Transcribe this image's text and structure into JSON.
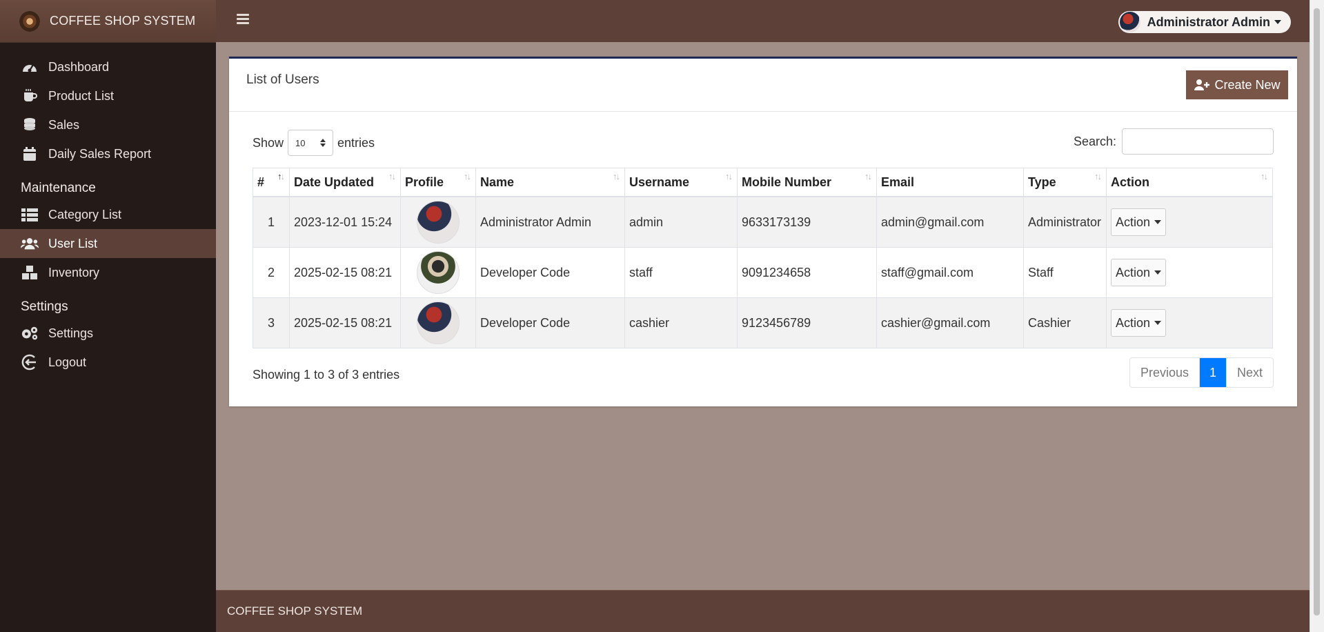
{
  "brand": {
    "title": "COFFEE SHOP SYSTEM"
  },
  "sidebar": {
    "items": [
      {
        "label": "Dashboard",
        "icon": "gauge-icon"
      },
      {
        "label": "Product List",
        "icon": "coffee-cup-icon"
      },
      {
        "label": "Sales",
        "icon": "coins-icon"
      },
      {
        "label": "Daily Sales Report",
        "icon": "calendar-icon"
      }
    ],
    "maintenance_header": "Maintenance",
    "maintenance_items": [
      {
        "label": "Category List",
        "icon": "table-list-icon"
      },
      {
        "label": "User List",
        "icon": "users-icon",
        "active": true
      },
      {
        "label": "Inventory",
        "icon": "boxes-icon"
      }
    ],
    "settings_header": "Settings",
    "settings_items": [
      {
        "label": "Settings",
        "icon": "gears-icon"
      },
      {
        "label": "Logout",
        "icon": "logout-icon"
      }
    ]
  },
  "topbar": {
    "user_name": "Administrator Admin"
  },
  "card": {
    "title": "List of Users",
    "create_label": "Create New",
    "show_label": "Show",
    "entries_label": "entries",
    "page_length": "10",
    "search_label": "Search:",
    "search_value": ""
  },
  "table": {
    "columns": [
      "#",
      "Date Updated",
      "Profile",
      "Name",
      "Username",
      "Mobile Number",
      "Email",
      "Type",
      "Action"
    ],
    "rows": [
      {
        "num": "1",
        "date": "2023-12-01 15:24",
        "name": "Administrator Admin",
        "username": "admin",
        "mobile": "9633173139",
        "email": "admin@gmail.com",
        "type": "Administrator",
        "action": "Action"
      },
      {
        "num": "2",
        "date": "2025-02-15 08:21",
        "name": "Developer Code",
        "username": "staff",
        "mobile": "9091234658",
        "email": "staff@gmail.com",
        "type": "Staff",
        "action": "Action"
      },
      {
        "num": "3",
        "date": "2025-02-15 08:21",
        "name": "Developer Code",
        "username": "cashier",
        "mobile": "9123456789",
        "email": "cashier@gmail.com",
        "type": "Cashier",
        "action": "Action"
      }
    ]
  },
  "footer_info": "Showing 1 to 3 of 3 entries",
  "pagination": {
    "previous": "Previous",
    "current": "1",
    "next": "Next"
  },
  "footer": {
    "text": "COFFEE SHOP SYSTEM"
  },
  "colors": {
    "sidebar_bg": "#241a17",
    "topbar_bg": "#5d4037",
    "content_bg": "#a18f87",
    "accent": "#795548",
    "active_page": "#007bff"
  }
}
